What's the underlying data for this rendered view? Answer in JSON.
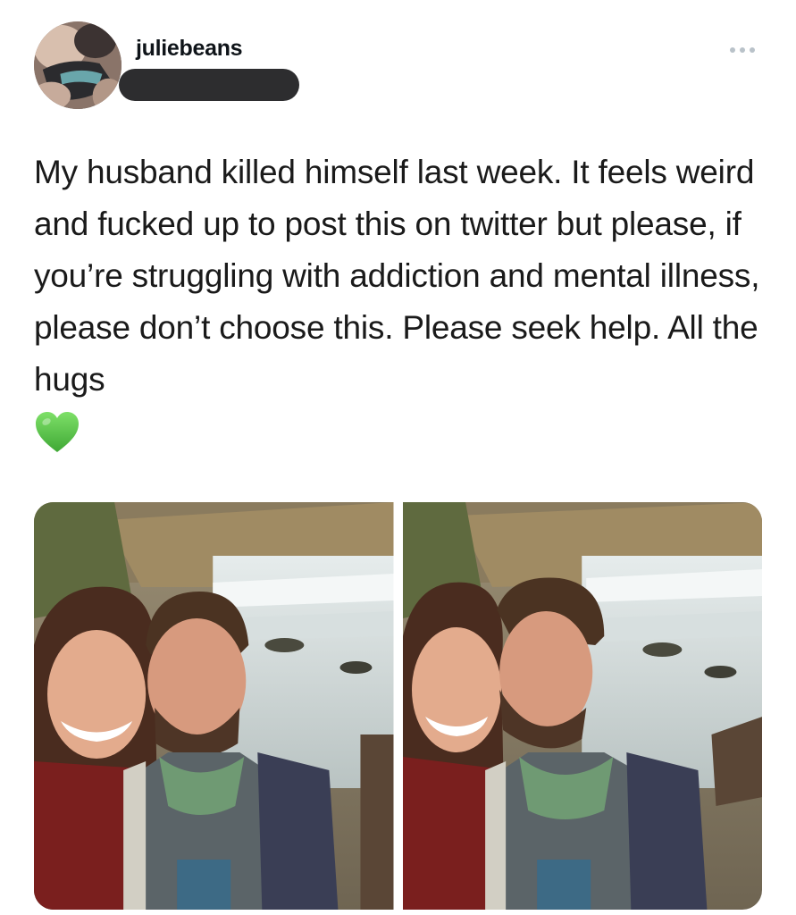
{
  "tweet": {
    "username": "juliebeans",
    "text": "My husband killed himself last week. It feels weird and fucked up to post this on twitter but please, if you’re struggling with addiction and mental illness, please don’t choose this. Please seek help. All the hugs",
    "emoji": "green-heart"
  },
  "icons": {
    "more": "more-horizontal-icon",
    "heart": "green-heart-icon"
  },
  "colors": {
    "text": "#0f1419",
    "redaction": "#2d2d2f",
    "heart": "#5cc94a",
    "more_dots": "#b9c2c9"
  },
  "media": {
    "count": 2,
    "photos": [
      {
        "name": "selfie-waterfall-1"
      },
      {
        "name": "selfie-waterfall-2"
      }
    ]
  }
}
